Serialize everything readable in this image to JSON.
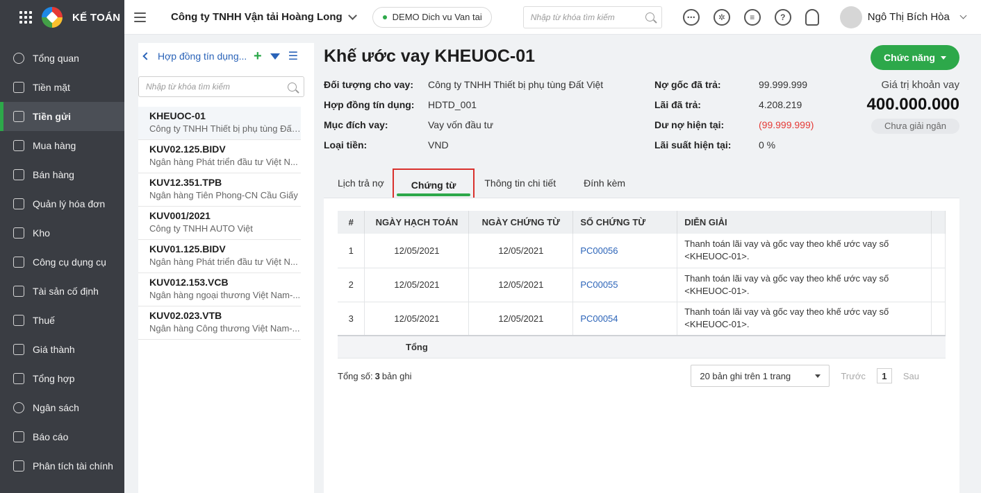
{
  "brand": {
    "name": "KẾ TOÁN"
  },
  "sidebar": {
    "items": [
      {
        "label": "Tổng quan",
        "icon": "speedometer-icon"
      },
      {
        "label": "Tiền mặt",
        "icon": "money-bag-icon"
      },
      {
        "label": "Tiền gửi",
        "icon": "bank-icon",
        "active": true
      },
      {
        "label": "Mua hàng",
        "icon": "shopping-bag-icon"
      },
      {
        "label": "Bán hàng",
        "icon": "cart-icon"
      },
      {
        "label": "Quản lý hóa đơn",
        "icon": "invoice-icon"
      },
      {
        "label": "Kho",
        "icon": "warehouse-icon"
      },
      {
        "label": "Công cụ dụng cụ",
        "icon": "tools-icon"
      },
      {
        "label": "Tài sản cố định",
        "icon": "car-icon"
      },
      {
        "label": "Thuế",
        "icon": "tax-icon"
      },
      {
        "label": "Giá thành",
        "icon": "price-tag-icon"
      },
      {
        "label": "Tổng hợp",
        "icon": "ledger-icon"
      },
      {
        "label": "Ngân sách",
        "icon": "budget-icon"
      },
      {
        "label": "Báo cáo",
        "icon": "bar-chart-icon"
      },
      {
        "label": "Phân tích tài chính",
        "icon": "analysis-icon"
      }
    ]
  },
  "topbar": {
    "company": "Công ty TNHH Vận tải Hoàng Long",
    "demo": "DEMO Dich vu Van tai",
    "search_placeholder": "Nhập từ khóa tìm kiếm",
    "user_name": "Ngô Thị Bích Hòa"
  },
  "list_panel": {
    "title": "Hợp đồng tín dụng...",
    "search_placeholder": "Nhập từ khóa tìm kiếm",
    "items": [
      {
        "code": "KHEUOC-01",
        "sub": "Công ty TNHH Thiết bị phụ tùng Đất...",
        "selected": true
      },
      {
        "code": "KUV02.125.BIDV",
        "sub": "Ngân hàng Phát triển đầu tư Việt N..."
      },
      {
        "code": "KUV12.351.TPB",
        "sub": "Ngân hàng Tiên Phong-CN Cầu Giấy"
      },
      {
        "code": "KUV001/2021",
        "sub": "Công ty TNHH AUTO Việt"
      },
      {
        "code": "KUV01.125.BIDV",
        "sub": "Ngân hàng Phát triển đầu tư Việt N..."
      },
      {
        "code": "KUV012.153.VCB",
        "sub": "Ngân hàng ngoại thương Việt Nam-..."
      },
      {
        "code": "KUV02.023.VTB",
        "sub": "Ngân hàng Công thương Việt Nam-..."
      }
    ]
  },
  "detail": {
    "title": "Khế ước vay KHEUOC-01",
    "function_button": "Chức năng",
    "left_info": [
      {
        "label": "Đối tượng cho vay:",
        "value": "Công ty TNHH Thiết bị phụ tùng Đất Việt"
      },
      {
        "label": "Hợp đồng tín dụng:",
        "value": "HDTD_001"
      },
      {
        "label": "Mục đích vay:",
        "value": "Vay vốn đầu tư"
      },
      {
        "label": "Loại tiền:",
        "value": "VND"
      }
    ],
    "right_info": [
      {
        "label": "Nợ gốc đã trả:",
        "value": "99.999.999"
      },
      {
        "label": "Lãi đã trả:",
        "value": "4.208.219"
      },
      {
        "label": "Dư nợ hiện tại:",
        "value": "(99.999.999)",
        "negative": true
      },
      {
        "label": "Lãi suất hiện tại:",
        "value": "0 %"
      }
    ],
    "value_label": "Giá trị khoản vay",
    "value_amount": "400.000.000",
    "status": "Chưa giải ngân"
  },
  "tabs": [
    {
      "label": "Lịch trả nợ"
    },
    {
      "label": "Chứng từ",
      "active": true
    },
    {
      "label": "Thông tin chi tiết"
    },
    {
      "label": "Đính kèm"
    }
  ],
  "table": {
    "headers": [
      "#",
      "NGÀY HẠCH TOÁN",
      "NGÀY CHỨNG TỪ",
      "SỐ CHỨNG TỪ",
      "DIỄN GIẢI"
    ],
    "rows": [
      {
        "no": "1",
        "posting_date": "12/05/2021",
        "doc_date": "12/05/2021",
        "doc_no": "PC00056",
        "desc": "Thanh toán lãi vay và gốc vay theo khế ước vay số <KHEUOC-01>."
      },
      {
        "no": "2",
        "posting_date": "12/05/2021",
        "doc_date": "12/05/2021",
        "doc_no": "PC00055",
        "desc": "Thanh toán lãi vay và gốc vay theo khế ước vay số <KHEUOC-01>."
      },
      {
        "no": "3",
        "posting_date": "12/05/2021",
        "doc_date": "12/05/2021",
        "doc_no": "PC00054",
        "desc": "Thanh toán lãi vay và gốc vay theo khế ước vay số <KHEUOC-01>."
      }
    ],
    "total_label": "Tổng"
  },
  "footer": {
    "total_prefix": "Tổng số:",
    "total_count": "3",
    "total_suffix": "bản ghi",
    "page_size": "20 bản ghi trên 1 trang",
    "prev": "Trước",
    "page": "1",
    "next": "Sau"
  }
}
